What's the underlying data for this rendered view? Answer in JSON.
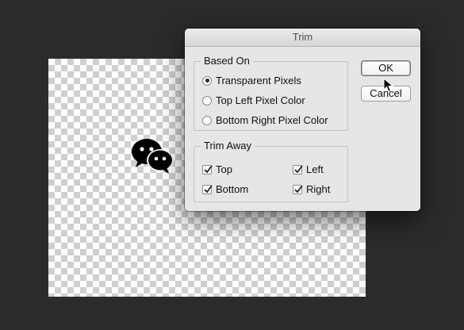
{
  "dialog": {
    "title": "Trim",
    "based_on": {
      "legend": "Based On",
      "options": [
        {
          "label": "Transparent Pixels",
          "selected": true
        },
        {
          "label": "Top Left Pixel Color",
          "selected": false
        },
        {
          "label": "Bottom Right Pixel Color",
          "selected": false
        }
      ]
    },
    "trim_away": {
      "legend": "Trim Away",
      "top": {
        "label": "Top",
        "checked": true
      },
      "left": {
        "label": "Left",
        "checked": true
      },
      "bottom": {
        "label": "Bottom",
        "checked": true
      },
      "right": {
        "label": "Right",
        "checked": true
      }
    },
    "ok_label": "OK",
    "cancel_label": "Cancel"
  },
  "colors": {
    "background": "#2b2b2b",
    "dialog": "#e6e6e6"
  },
  "icons": {
    "canvas_graphic": "wechat-icon",
    "pointer": "arrow-cursor-icon"
  }
}
